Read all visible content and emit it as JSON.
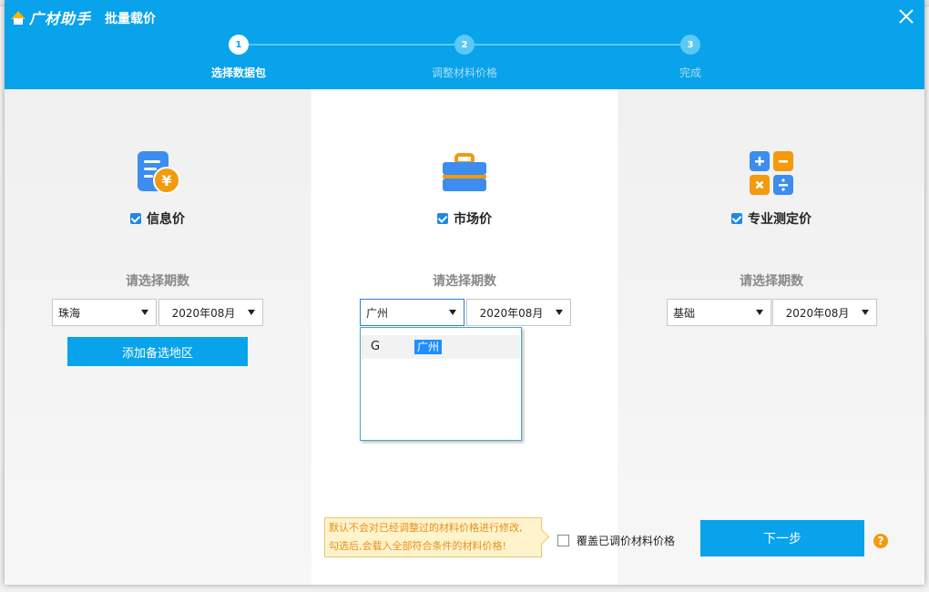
{
  "app": {
    "logo_text": "广材助手",
    "dialog_title": "批量载价"
  },
  "steps": [
    {
      "number": "1",
      "label": "选择数据包"
    },
    {
      "number": "2",
      "label": "调整材料价格"
    },
    {
      "number": "3",
      "label": "完成"
    }
  ],
  "columns": {
    "info": {
      "label": "信息价",
      "period_label": "请选择期数",
      "region": "珠海",
      "period": "2020年08月",
      "add_region_label": "添加备选地区"
    },
    "market": {
      "label": "市场价",
      "period_label": "请选择期数",
      "region": "广州",
      "period": "2020年08月"
    },
    "professional": {
      "label": "专业测定价",
      "period_label": "请选择期数",
      "region": "基础",
      "period": "2020年08月"
    }
  },
  "dropdown": {
    "group": "G",
    "item": "广州"
  },
  "footer": {
    "tip_line1": "默认不会对已经调整过的材料价格进行修改,",
    "tip_line2": "勾选后,会载入全部符合条件的材料价格!",
    "overwrite_label": "覆盖已调价材料价格",
    "next_label": "下一步",
    "help_glyph": "?"
  },
  "colors": {
    "primary": "#08a3ea",
    "accent_orange": "#f39a0e",
    "checkbox": "#1e88e5"
  }
}
